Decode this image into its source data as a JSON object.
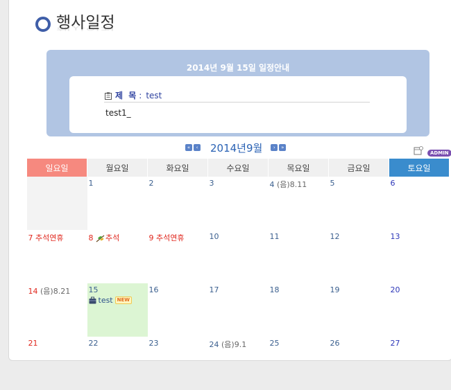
{
  "page": {
    "title": "행사일정"
  },
  "notice": {
    "header": "2014년 9월 15일 일정안내",
    "subject_label": "제 목",
    "subject_colon": ":",
    "subject_value": "test",
    "content": "test1_"
  },
  "calendar": {
    "month_title": "2014년9월",
    "admin_badge": "ADMIN",
    "weekdays": [
      "일요일",
      "월요일",
      "화요일",
      "수요일",
      "목요일",
      "금요일",
      "토요일"
    ],
    "weeks": [
      [
        {
          "day": ""
        },
        {
          "day": "1"
        },
        {
          "day": "2"
        },
        {
          "day": "3"
        },
        {
          "day": "4",
          "lunar": "(음)8.11"
        },
        {
          "day": "5"
        },
        {
          "day": "6"
        }
      ],
      [
        {
          "day": "7",
          "holiday": "추석연휴"
        },
        {
          "day": "8",
          "holiday": "추석"
        },
        {
          "day": "9",
          "holiday": "추석연휴"
        },
        {
          "day": "10"
        },
        {
          "day": "11"
        },
        {
          "day": "12"
        },
        {
          "day": "13"
        }
      ],
      [
        {
          "day": "14",
          "lunar": "(음)8.21"
        },
        {
          "day": "15",
          "event": "test",
          "event_badge": "NEW"
        },
        {
          "day": "16"
        },
        {
          "day": "17"
        },
        {
          "day": "18"
        },
        {
          "day": "19"
        },
        {
          "day": "20"
        }
      ],
      [
        {
          "day": "21"
        },
        {
          "day": "22"
        },
        {
          "day": "23"
        },
        {
          "day": "24",
          "lunar": "(음)9.1"
        },
        {
          "day": "25"
        },
        {
          "day": "26"
        },
        {
          "day": "27"
        }
      ]
    ]
  },
  "colors": {
    "notice_bg": "#b1c5e3",
    "sunday": "#f6897f",
    "saturday": "#3a8ccd",
    "today": "#dcf5d3",
    "holiday_text": "#e0261c"
  }
}
